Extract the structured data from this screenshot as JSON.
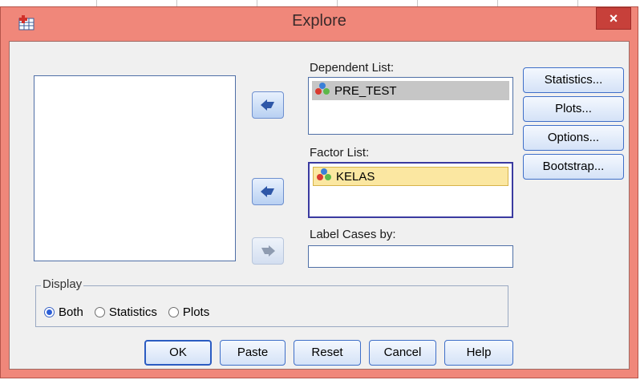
{
  "window": {
    "title": "Explore",
    "close_label": "×"
  },
  "labels": {
    "dependent_list": "Dependent List:",
    "factor_list": "Factor List:",
    "label_cases": "Label Cases by:"
  },
  "dependent_items": [
    "PRE_TEST"
  ],
  "factor_items": [
    "KELAS"
  ],
  "side_buttons": {
    "statistics": "Statistics...",
    "plots": "Plots...",
    "options": "Options...",
    "bootstrap": "Bootstrap..."
  },
  "display": {
    "title": "Display",
    "options": [
      "Both",
      "Statistics",
      "Plots"
    ],
    "selected": "Both"
  },
  "bottom_buttons": {
    "ok": "OK",
    "paste": "Paste",
    "reset": "Reset",
    "cancel": "Cancel",
    "help": "Help"
  },
  "icon_names": {
    "title": "spss-explore-icon",
    "variable": "nominal-variable-icon",
    "move_in": "arrow-left-icon",
    "move_out": "arrow-right-icon"
  }
}
